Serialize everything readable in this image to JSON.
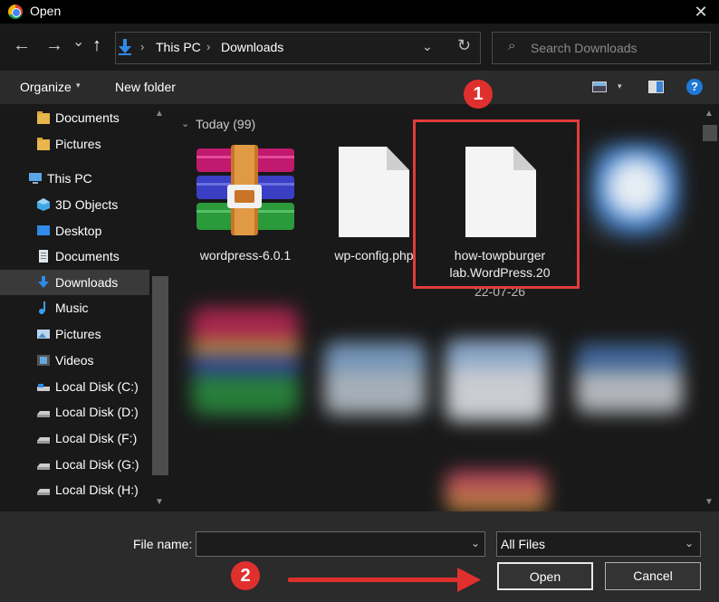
{
  "window": {
    "title": "Open",
    "close_glyph": "✕"
  },
  "nav": {
    "back_glyph": "←",
    "forward_glyph": "→",
    "recent_glyph": "⌄",
    "up_glyph": "↑",
    "breadcrumb": [
      "This PC",
      "Downloads"
    ],
    "separator": "›",
    "dropdown_glyph": "⌄",
    "refresh_glyph": "↻",
    "search_placeholder": "Search Downloads",
    "search_glyph": "⌕"
  },
  "toolbar": {
    "organize": "Organize",
    "caret": "▾",
    "new_folder": "New folder",
    "help": "?"
  },
  "sidebar": {
    "items": [
      {
        "label": "Documents",
        "icon": "folder-icon"
      },
      {
        "label": "Pictures",
        "icon": "folder-icon"
      },
      {
        "label": "This PC",
        "icon": "computer-icon"
      },
      {
        "label": "3D Objects",
        "icon": "cube-icon"
      },
      {
        "label": "Desktop",
        "icon": "desktop-icon"
      },
      {
        "label": "Documents",
        "icon": "document-icon"
      },
      {
        "label": "Downloads",
        "icon": "download-icon",
        "selected": true
      },
      {
        "label": "Music",
        "icon": "music-icon"
      },
      {
        "label": "Pictures",
        "icon": "picture-icon"
      },
      {
        "label": "Videos",
        "icon": "video-icon"
      },
      {
        "label": "Local Disk (C:)",
        "icon": "drive-icon"
      },
      {
        "label": "Local Disk (D:)",
        "icon": "drive-icon"
      },
      {
        "label": "Local Disk (F:)",
        "icon": "drive-icon"
      },
      {
        "label": "Local Disk (G:)",
        "icon": "drive-icon"
      },
      {
        "label": "Local Disk (H:)",
        "icon": "drive-icon"
      }
    ],
    "scroll_up": "▲",
    "scroll_down": "▼"
  },
  "content": {
    "group": "Today (99)",
    "group_chevron": "⌄",
    "files": [
      {
        "name": "wordpress-6.0.1",
        "icon": "archive-icon"
      },
      {
        "name": "wp-config.php",
        "icon": "blank-file-icon"
      },
      {
        "name_line1": "how-towpburger",
        "name_line2": "lab.WordPress.20",
        "name_line3": "22-07-26",
        "icon": "blank-file-icon"
      }
    ],
    "scroll_up": "▲",
    "scroll_down": "▼"
  },
  "annotations": {
    "badge1": "1",
    "badge2": "2",
    "color": "#e0302d"
  },
  "footer": {
    "file_name_label": "File name:",
    "file_name_value": "",
    "filter": "All Files",
    "caret": "⌄",
    "open": "Open",
    "cancel": "Cancel"
  }
}
